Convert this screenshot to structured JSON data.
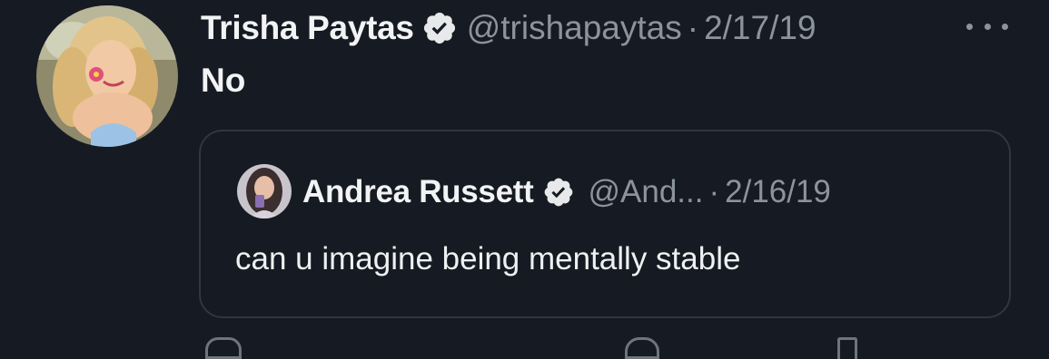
{
  "tweet": {
    "author_name": "Trisha Paytas",
    "author_handle": "@trishapaytas",
    "separator": "·",
    "date": "2/17/19",
    "text": "No",
    "verified_icon": "verified-badge-icon",
    "more_icon": "more-options-icon"
  },
  "quoted_tweet": {
    "author_name": "Andrea Russett",
    "author_handle": "@And...",
    "separator": "·",
    "date": "2/16/19",
    "text": "can u imagine being mentally stable",
    "verified_icon": "verified-badge-icon"
  },
  "actions": [
    {
      "icon": "reply-icon"
    },
    {
      "icon": "like-icon"
    },
    {
      "icon": "share-icon"
    }
  ],
  "colors": {
    "background": "#161a22",
    "primary_text": "#f2f3f4",
    "secondary_text": "#8b949c",
    "quote_border": "#2f3740"
  }
}
